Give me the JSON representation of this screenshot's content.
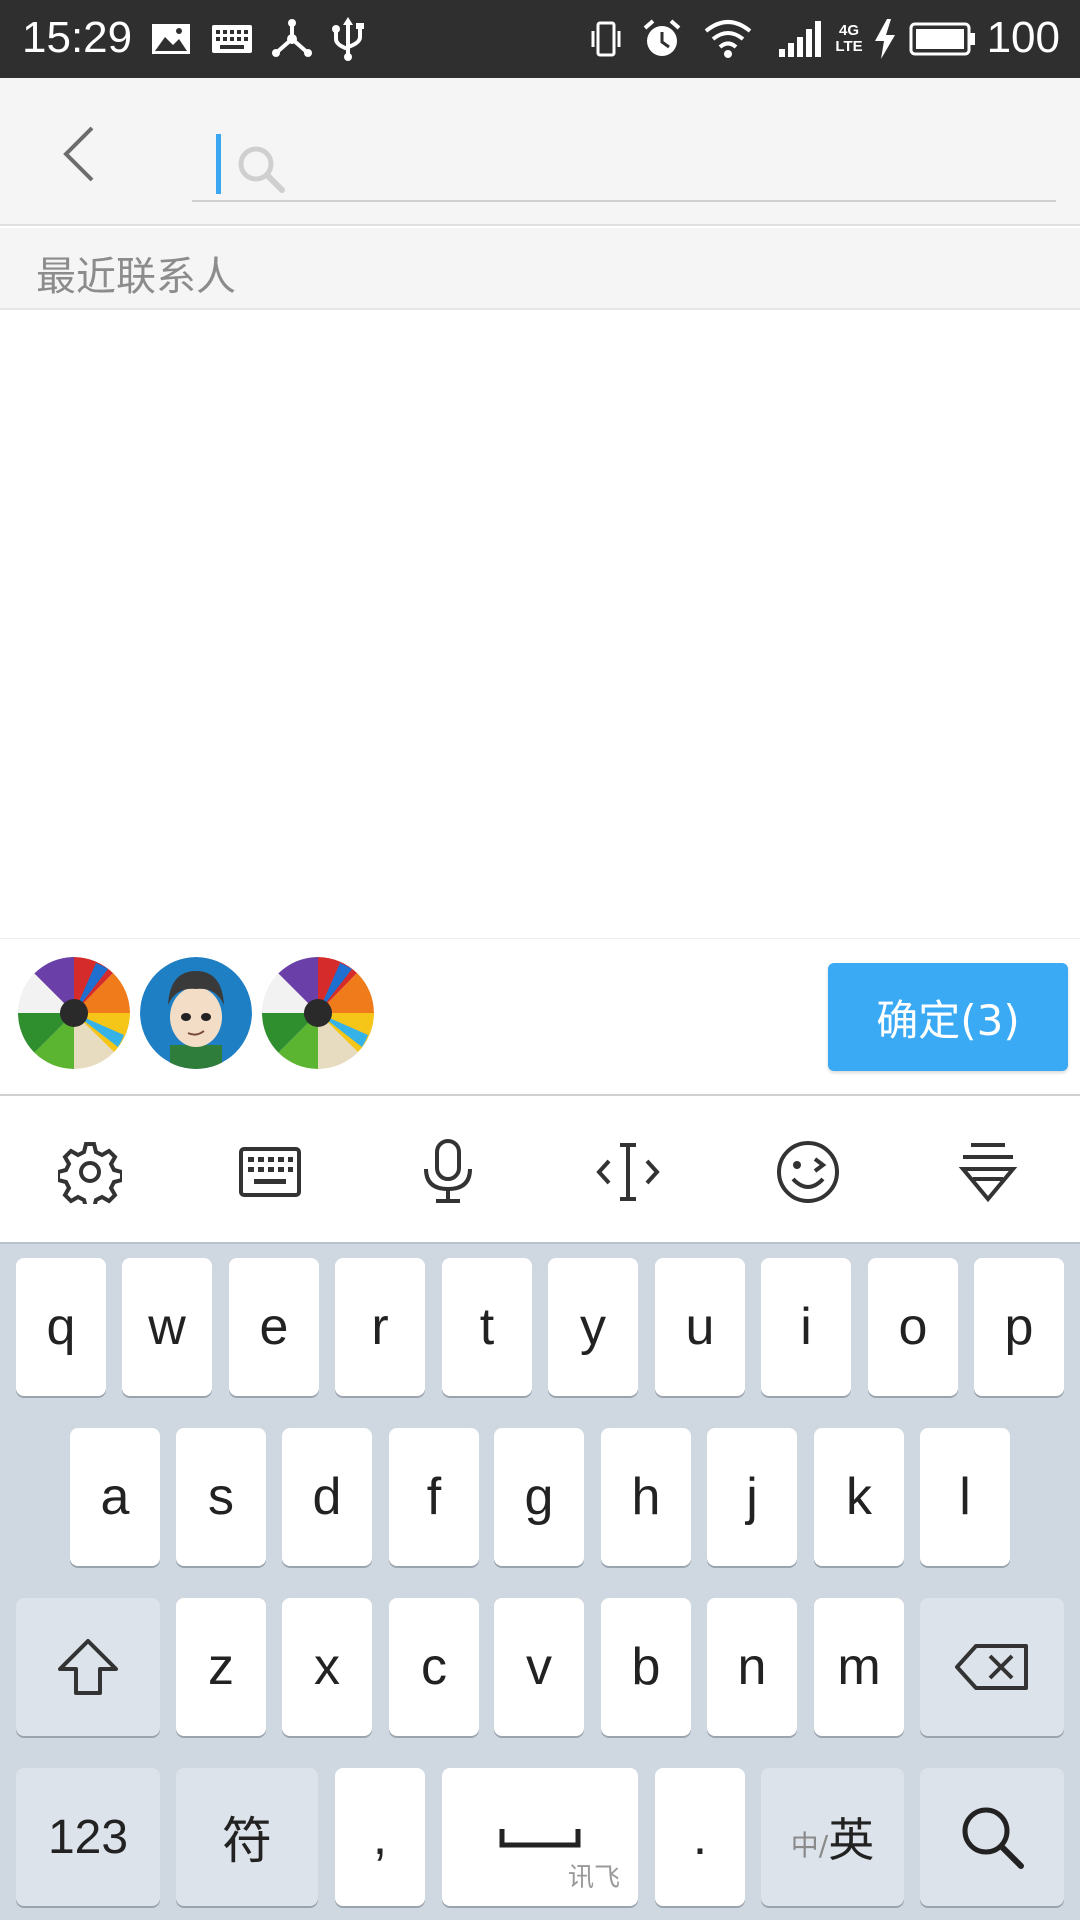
{
  "status_bar": {
    "time": "15:29",
    "battery": "100",
    "network": "4G LTE",
    "left_icons": [
      "image-icon",
      "keyboard-icon",
      "share-network-icon",
      "usb-icon"
    ],
    "right_icons": [
      "vibrate-icon",
      "alarm-icon",
      "wifi-icon",
      "signal-icon",
      "charging-icon",
      "battery-icon"
    ]
  },
  "header": {
    "search_placeholder": ""
  },
  "section": {
    "title": "最近联系人"
  },
  "selected": {
    "avatars": [
      "colored-pencils-avatar",
      "cartoon-face-avatar",
      "colored-pencils-avatar"
    ],
    "confirm_label": "确定(3)"
  },
  "keyboard": {
    "toolbar": [
      "gear-icon",
      "keyboard-icon",
      "microphone-icon",
      "cursor-move-icon",
      "emoji-icon",
      "hide-keyboard-icon"
    ],
    "row1": [
      "q",
      "w",
      "e",
      "r",
      "t",
      "y",
      "u",
      "i",
      "o",
      "p"
    ],
    "row2": [
      "a",
      "s",
      "d",
      "f",
      "g",
      "h",
      "j",
      "k",
      "l"
    ],
    "row3": [
      "z",
      "x",
      "c",
      "v",
      "b",
      "n",
      "m"
    ],
    "numbers_label": "123",
    "symbols_label": "符",
    "comma": ",",
    "space_brand": "讯飞",
    "period": ".",
    "lang_cn": "中/",
    "lang_en": "英"
  },
  "colors": {
    "accent": "#3aaaf5",
    "status_bar": "#2f2f2f",
    "keyboard_bg": "#cfd7e0"
  }
}
